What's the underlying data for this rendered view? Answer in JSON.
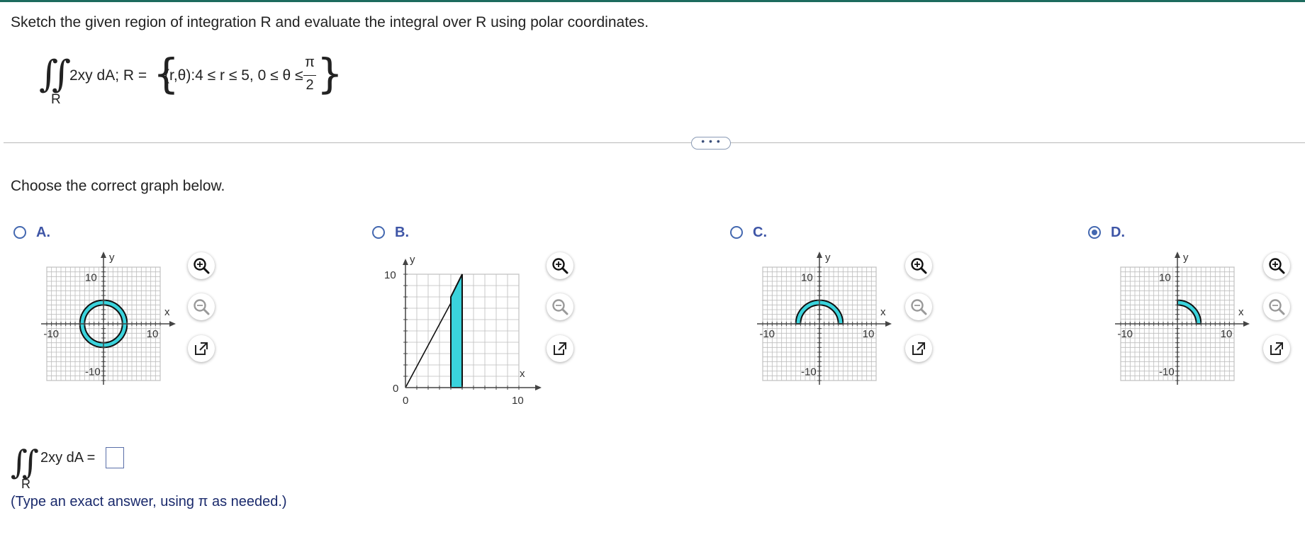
{
  "question": {
    "text": "Sketch the given region of integration R and evaluate the integral over R using polar coordinates.",
    "integrand": "2xy dA; R =",
    "region_label": "R",
    "region_set": "(r,θ):4 ≤ r ≤ 5, 0 ≤ θ ≤",
    "pi_numerator": "π",
    "pi_denominator": "2"
  },
  "divider": {
    "more_label": "• • •"
  },
  "prompt": "Choose the correct graph below.",
  "options": [
    {
      "letter": "A.",
      "selected": false,
      "axis_min_label": "-10",
      "axis_max_label": "10",
      "x_label": "x",
      "y_label": "y",
      "region": "full ring 4 ≤ r ≤ 5"
    },
    {
      "letter": "B.",
      "selected": false,
      "axis_min_label": "0",
      "axis_max_label": "10",
      "y_max_label": "10",
      "x_label": "x",
      "y_label": "y",
      "region": "rectangle 4 ≤ x ≤ 5"
    },
    {
      "letter": "C.",
      "selected": false,
      "axis_min_label": "-10",
      "axis_max_label": "10",
      "x_label": "x",
      "y_label": "y",
      "region": "upper half ring 4 ≤ r ≤ 5"
    },
    {
      "letter": "D.",
      "selected": true,
      "axis_min_label": "-10",
      "axis_max_label": "10",
      "x_label": "x",
      "y_label": "y",
      "region": "quarter ring 4 ≤ r ≤ 5, first quadrant"
    }
  ],
  "tools": {
    "zoom_in": "zoom-in-icon",
    "zoom_out": "zoom-out-icon",
    "popout": "popout-icon"
  },
  "answer": {
    "integrand": "2xy dA =",
    "region_label": "R",
    "value": "",
    "hint": "(Type an exact answer, using π as needed.)"
  },
  "colors": {
    "region_fill": "#3ad3dc",
    "accent": "#4468b0",
    "grid": "#bdbdbd"
  }
}
